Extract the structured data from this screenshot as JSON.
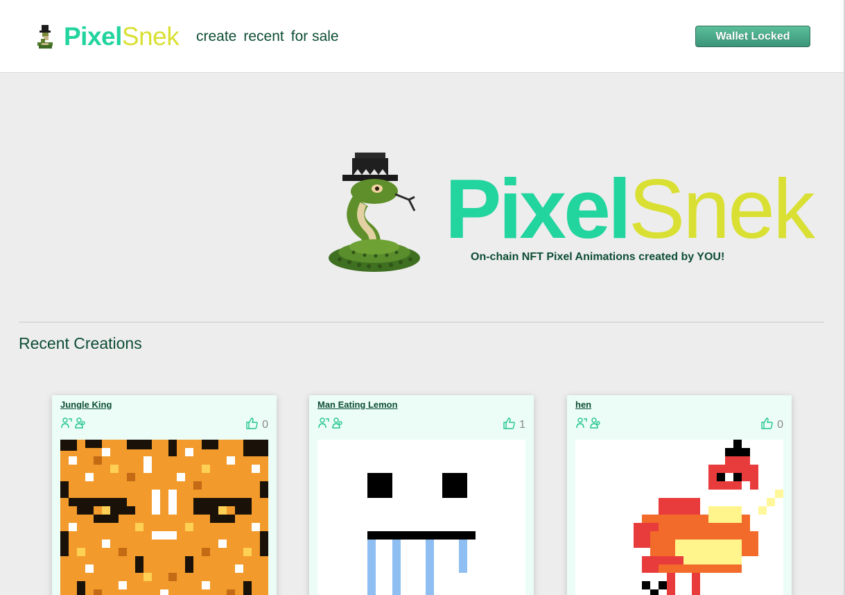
{
  "header": {
    "brand_part1": "Pixel",
    "brand_part2": "Snek",
    "nav": [
      "create",
      "recent",
      "for sale"
    ],
    "wallet_button": "Wallet Locked"
  },
  "hero": {
    "title_part1": "Pixel",
    "title_part2": "Snek",
    "tagline": "On-chain NFT Pixel Animations created by YOU!"
  },
  "recent": {
    "heading": "Recent Creations",
    "cards": [
      {
        "title": "Jungle King",
        "likes": "0"
      },
      {
        "title": "Man Eating Lemon",
        "likes": "1"
      },
      {
        "title": "hen",
        "likes": "0"
      }
    ]
  },
  "colors": {
    "brand_green": "#22d49e",
    "brand_yellow": "#d9e033",
    "text_dark_green": "#0d4d34",
    "card_bg": "#ebfdf6"
  },
  "icons": [
    "snake-logo-icon",
    "transfer-icon",
    "people-icon",
    "thumbs-up-icon"
  ]
}
